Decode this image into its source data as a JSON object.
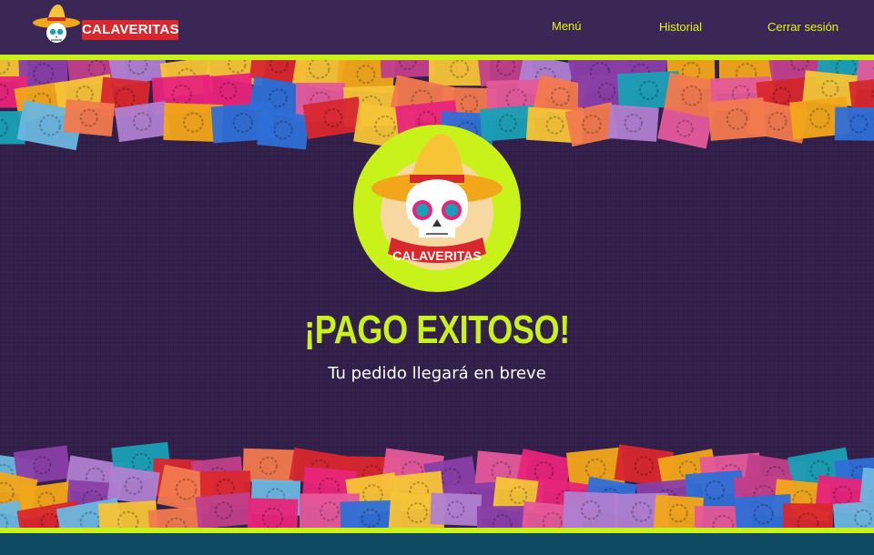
{
  "header": {
    "logo_text": "CALAVERITAS",
    "nav": [
      {
        "label": "Menú"
      },
      {
        "label": "Historial"
      },
      {
        "label": "Cerrar sesión"
      }
    ]
  },
  "main": {
    "emblem_text": "CALAVERITAS",
    "title": "¡PAGO EXITOSO!",
    "subtitle": "Tu pedido llegará en breve"
  },
  "colors": {
    "header_bg": "#3a2756",
    "accent": "#c8f21a",
    "nav_text": "#e6f50f",
    "page_bg": "#35214d",
    "footer_bg": "#0f4a63",
    "brand_red": "#d9272e"
  },
  "icons": [
    "sombrero-skull-icon",
    "papel-picado-banner"
  ]
}
